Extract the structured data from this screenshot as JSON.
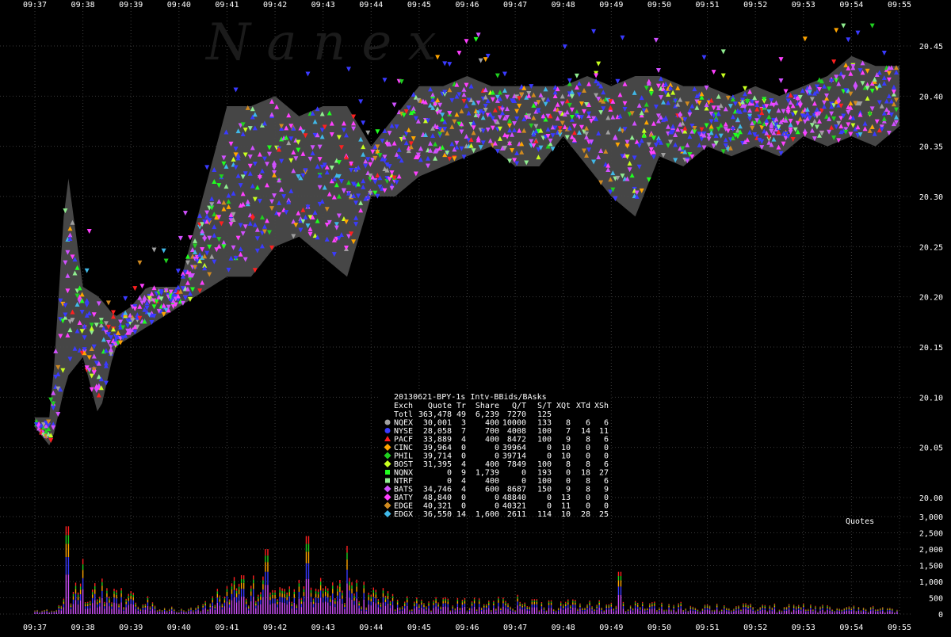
{
  "watermark": "N a n e x",
  "colors": {
    "background": "#000000",
    "grid": "#3a3a3a",
    "bbo_band": "#4a4a4a",
    "axis_text": "#ffffff"
  },
  "chart_data": [
    {
      "type": "scatter",
      "title": "20130621-BPY-1s Intv-BBids/BAsks",
      "xlabel": "",
      "ylabel": "",
      "x_ticks": [
        "09:37",
        "09:38",
        "09:39",
        "09:40",
        "09:41",
        "09:42",
        "09:43",
        "09:44",
        "09:45",
        "09:46",
        "09:47",
        "09:48",
        "09:49",
        "09:50",
        "09:51",
        "09:52",
        "09:53",
        "09:54",
        "09:55"
      ],
      "x_range": [
        "09:37",
        "09:55"
      ],
      "y_ticks": [
        "20.00",
        "20.05",
        "20.10",
        "20.15",
        "20.20",
        "20.25",
        "20.30",
        "20.35",
        "20.40",
        "20.45"
      ],
      "ylim": [
        19.98,
        20.48
      ],
      "grid": true,
      "best_bid_ask_band": {
        "time": [
          "09:37",
          "09:37:20",
          "09:37:40",
          "09:38",
          "09:38:20",
          "09:38:40",
          "09:39",
          "09:39:20",
          "09:39:40",
          "09:40",
          "09:41",
          "09:41:30",
          "09:42",
          "09:42:30",
          "09:43",
          "09:43:30",
          "09:44",
          "09:44:30",
          "09:45",
          "09:45:30",
          "09:46",
          "09:46:30",
          "09:47",
          "09:47:30",
          "09:48",
          "09:48:30",
          "09:49",
          "09:49:30",
          "09:50",
          "09:50:30",
          "09:51",
          "09:51:30",
          "09:52",
          "09:52:30",
          "09:53",
          "09:53:30",
          "09:54",
          "09:54:30",
          "09:55"
        ],
        "bid": [
          20.07,
          20.05,
          20.12,
          20.14,
          20.08,
          20.15,
          20.16,
          20.17,
          20.18,
          20.19,
          20.22,
          20.22,
          20.25,
          20.26,
          20.24,
          20.22,
          20.3,
          20.3,
          20.32,
          20.33,
          20.34,
          20.35,
          20.33,
          20.33,
          20.36,
          20.33,
          20.3,
          20.28,
          20.34,
          20.33,
          20.35,
          20.34,
          20.35,
          20.34,
          20.36,
          20.35,
          20.36,
          20.35,
          20.37
        ],
        "ask": [
          20.08,
          20.08,
          20.33,
          20.21,
          20.2,
          20.18,
          20.19,
          20.21,
          20.21,
          20.21,
          20.39,
          20.39,
          20.4,
          20.38,
          20.39,
          20.39,
          20.35,
          20.38,
          20.41,
          20.41,
          20.42,
          20.41,
          20.41,
          20.41,
          20.41,
          20.42,
          20.41,
          20.42,
          20.42,
          20.41,
          20.41,
          20.4,
          20.41,
          20.4,
          20.41,
          20.42,
          20.44,
          20.43,
          20.43
        ]
      },
      "series": [
        {
          "name": "NQEX",
          "color": "#a0a0a0"
        },
        {
          "name": "NYSE",
          "color": "#3a3aff"
        },
        {
          "name": "PACF",
          "color": "#ff2020"
        },
        {
          "name": "CINC",
          "color": "#ffa500"
        },
        {
          "name": "PHIL",
          "color": "#20d020"
        },
        {
          "name": "BOST",
          "color": "#c8ff20"
        },
        {
          "name": "NQNX",
          "color": "#20ff20"
        },
        {
          "name": "NTRF",
          "color": "#90ee90"
        },
        {
          "name": "BATS",
          "color": "#d050ff"
        },
        {
          "name": "BATY",
          "color": "#ff40ff"
        },
        {
          "name": "EDGE",
          "color": "#d08a20"
        },
        {
          "name": "EDGX",
          "color": "#40b8e8"
        }
      ]
    },
    {
      "type": "bar",
      "title": "",
      "annotation": "Quotes",
      "xlabel": "",
      "ylabel": "",
      "y_ticks": [
        "0",
        "500",
        "1,000",
        "1,500",
        "2,000",
        "2,500",
        "3,000"
      ],
      "ylim": [
        0,
        3000
      ],
      "grid": true,
      "time_range": [
        "09:37",
        "09:55"
      ],
      "bin_seconds": 3,
      "peak_values": [
        {
          "time": "09:37:40",
          "value": 2700
        },
        {
          "time": "09:38:00",
          "value": 1700
        },
        {
          "time": "09:41:50",
          "value": 2000
        },
        {
          "time": "09:42:40",
          "value": 2400
        },
        {
          "time": "09:43:30",
          "value": 2100
        },
        {
          "time": "09:49:10",
          "value": 1300
        }
      ],
      "envelope": {
        "time": [
          "09:37",
          "09:37:30",
          "09:38",
          "09:39",
          "09:40",
          "09:40:30",
          "09:41",
          "09:42",
          "09:43",
          "09:44",
          "09:45",
          "09:46",
          "09:47",
          "09:48",
          "09:49",
          "09:50",
          "09:51",
          "09:52",
          "09:53",
          "09:54",
          "09:55"
        ],
        "value": [
          100,
          250,
          1200,
          700,
          150,
          300,
          1100,
          1400,
          1300,
          900,
          500,
          450,
          550,
          450,
          400,
          350,
          350,
          300,
          300,
          250,
          200
        ]
      }
    }
  ],
  "stats_table": {
    "title": "20130621-BPY-1s Intv-BBids/BAsks",
    "headers": [
      "Exch",
      "Quote",
      "Tr",
      "Share",
      "Q/T",
      "S/T",
      "XQt",
      "XTd",
      "XSh"
    ],
    "rows": [
      {
        "exch": "Totl",
        "quote": "363,478",
        "tr": "49",
        "share": "6,239",
        "qt": "7270",
        "st": "125",
        "xqt": "",
        "xtd": "",
        "xsh": "",
        "marker": "none",
        "color": ""
      },
      {
        "exch": "NQEX",
        "quote": "30,001",
        "tr": "3",
        "share": "400",
        "qt": "10000",
        "st": "133",
        "xqt": "8",
        "xtd": "6",
        "xsh": "6",
        "marker": "circle",
        "color": "#a0a0a0"
      },
      {
        "exch": "NYSE",
        "quote": "28,058",
        "tr": "7",
        "share": "700",
        "qt": "4008",
        "st": "100",
        "xqt": "7",
        "xtd": "14",
        "xsh": "11",
        "marker": "circle",
        "color": "#3a3aff"
      },
      {
        "exch": "PACF",
        "quote": "33,889",
        "tr": "4",
        "share": "400",
        "qt": "8472",
        "st": "100",
        "xqt": "9",
        "xtd": "8",
        "xsh": "6",
        "marker": "triangle",
        "color": "#ff2020"
      },
      {
        "exch": "CINC",
        "quote": "39,964",
        "tr": "0",
        "share": "0",
        "qt": "39964",
        "st": "0",
        "xqt": "10",
        "xtd": "0",
        "xsh": "0",
        "marker": "diamond",
        "color": "#ffa500"
      },
      {
        "exch": "PHIL",
        "quote": "39,714",
        "tr": "0",
        "share": "0",
        "qt": "39714",
        "st": "0",
        "xqt": "10",
        "xtd": "0",
        "xsh": "0",
        "marker": "diamond",
        "color": "#20d020"
      },
      {
        "exch": "BOST",
        "quote": "31,395",
        "tr": "4",
        "share": "400",
        "qt": "7849",
        "st": "100",
        "xqt": "8",
        "xtd": "8",
        "xsh": "6",
        "marker": "diamond",
        "color": "#c8ff20"
      },
      {
        "exch": "NQNX",
        "quote": "0",
        "tr": "9",
        "share": "1,739",
        "qt": "0",
        "st": "193",
        "xqt": "0",
        "xtd": "18",
        "xsh": "27",
        "marker": "square",
        "color": "#20ff20"
      },
      {
        "exch": "NTRF",
        "quote": "0",
        "tr": "4",
        "share": "400",
        "qt": "0",
        "st": "100",
        "xqt": "0",
        "xtd": "8",
        "xsh": "6",
        "marker": "square",
        "color": "#90ee90"
      },
      {
        "exch": "BATS",
        "quote": "34,746",
        "tr": "4",
        "share": "600",
        "qt": "8687",
        "st": "150",
        "xqt": "9",
        "xtd": "8",
        "xsh": "9",
        "marker": "diamond",
        "color": "#d050ff"
      },
      {
        "exch": "BATY",
        "quote": "48,840",
        "tr": "0",
        "share": "0",
        "qt": "48840",
        "st": "0",
        "xqt": "13",
        "xtd": "0",
        "xsh": "0",
        "marker": "diamond",
        "color": "#ff40ff"
      },
      {
        "exch": "EDGE",
        "quote": "40,321",
        "tr": "0",
        "share": "0",
        "qt": "40321",
        "st": "0",
        "xqt": "11",
        "xtd": "0",
        "xsh": "0",
        "marker": "diamond",
        "color": "#d08a20"
      },
      {
        "exch": "EDGX",
        "quote": "36,550",
        "tr": "14",
        "share": "1,600",
        "qt": "2611",
        "st": "114",
        "xqt": "10",
        "xtd": "28",
        "xsh": "25",
        "marker": "diamond",
        "color": "#40b8e8"
      }
    ]
  }
}
